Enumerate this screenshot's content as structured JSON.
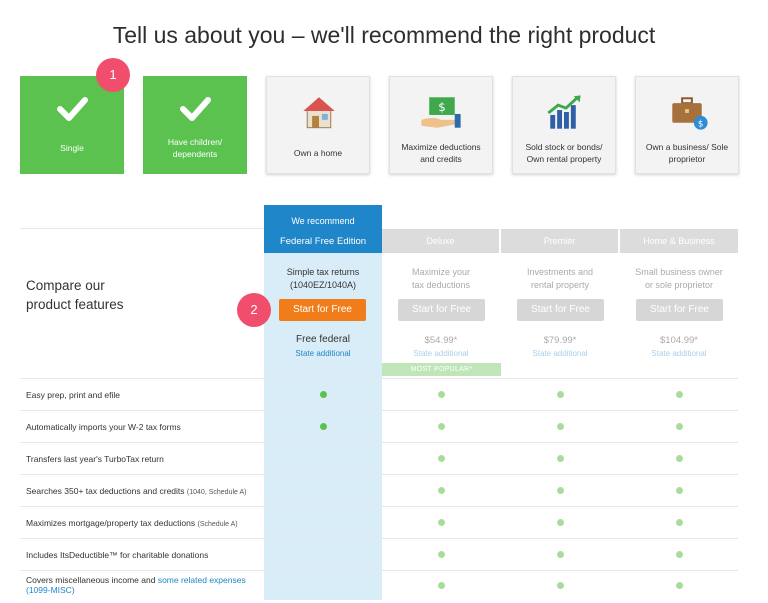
{
  "page_title": "Tell us about you – we'll recommend the right product",
  "cards": [
    {
      "label": "Single",
      "selected": true,
      "icon": "check-icon"
    },
    {
      "label": "Have children/ dependents",
      "selected": true,
      "icon": "check-icon"
    },
    {
      "label": "Own a home",
      "selected": false,
      "icon": "house-icon"
    },
    {
      "label": "Maximize deductions and credits",
      "selected": false,
      "icon": "money-hand-icon"
    },
    {
      "label": "Sold stock or bonds/ Own rental property",
      "selected": false,
      "icon": "bar-chart-arrow-icon"
    },
    {
      "label": "Own a business/ Sole proprietor",
      "selected": false,
      "icon": "briefcase-dollar-icon"
    }
  ],
  "badges": [
    "1",
    "2"
  ],
  "compare_heading": "Compare our product features",
  "recommend": {
    "line1": "We recommend",
    "line2": "Federal Free Edition"
  },
  "products": [
    {
      "name": "Federal Free Edition",
      "desc": "Simple tax returns (1040EZ/1040A)",
      "button": "Start for Free",
      "price": "Free federal",
      "state": "State additional"
    },
    {
      "name": "Deluxe",
      "desc": "Maximize your tax deductions",
      "button": "Start for Free",
      "price": "$54.99*",
      "state": "State additional",
      "badge": "MOST POPULAR*"
    },
    {
      "name": "Premier",
      "desc": "Investments and rental property",
      "button": "Start for Free",
      "price": "$79.99*",
      "state": "State additional"
    },
    {
      "name": "Home & Business",
      "desc": "Small business owner or sole proprietor",
      "button": "Start for Free",
      "price": "$104.99*",
      "state": "State additional"
    }
  ],
  "features": [
    {
      "text": "Easy prep, print and efile",
      "note": "",
      "included": [
        true,
        true,
        true,
        true
      ]
    },
    {
      "text": "Automatically imports your W-2 tax forms",
      "note": "",
      "included": [
        true,
        true,
        true,
        true
      ]
    },
    {
      "text": "Transfers last year's TurboTax return",
      "note": "",
      "included": [
        false,
        true,
        true,
        true
      ]
    },
    {
      "text": "Searches 350+ tax deductions and credits",
      "note": "(1040, Schedule A)",
      "included": [
        false,
        true,
        true,
        true
      ]
    },
    {
      "text": "Maximizes mortgage/property tax deductions",
      "note": "(Schedule A)",
      "included": [
        false,
        true,
        true,
        true
      ]
    },
    {
      "text": "Includes ItsDeductible™ for charitable donations",
      "note": "",
      "included": [
        false,
        true,
        true,
        true
      ]
    },
    {
      "text": "Covers miscellaneous income and",
      "link": "some related expenses",
      "link2": "(1099-MISC)",
      "included": [
        false,
        true,
        true,
        true
      ]
    }
  ],
  "colors": {
    "green": "#5bc24f",
    "blue": "#1f86c9",
    "orange": "#f07d1a",
    "badge": "#f14d6d",
    "gray_btn": "#d6d6d6"
  }
}
